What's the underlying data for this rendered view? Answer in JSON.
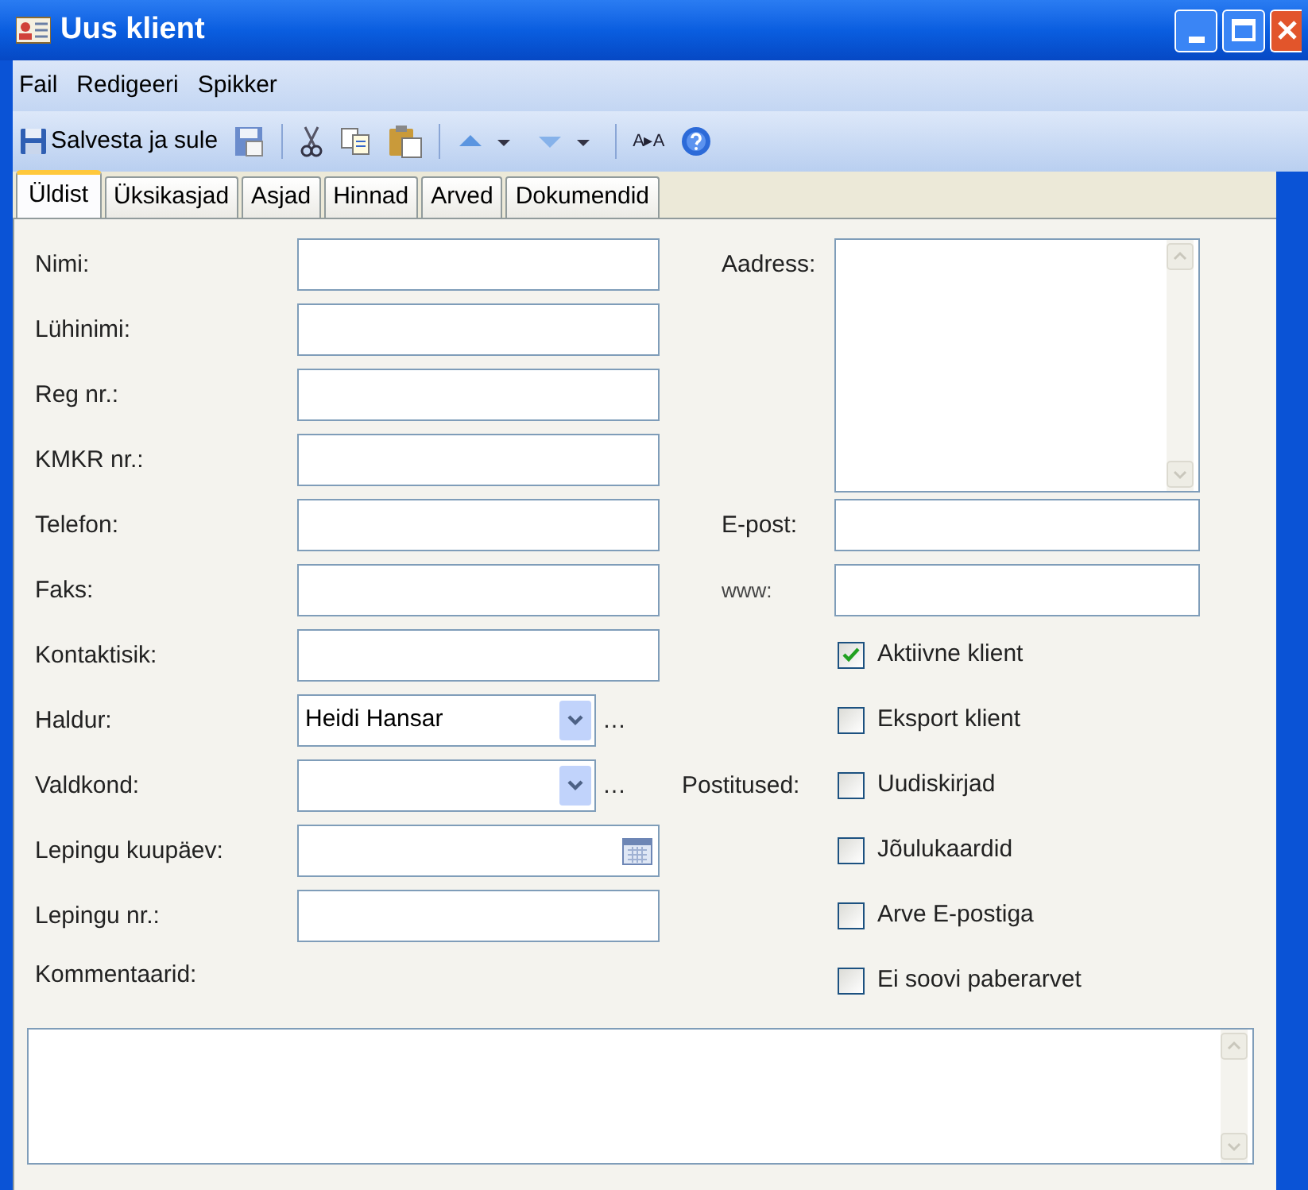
{
  "window": {
    "title": "Uus klient"
  },
  "menu": [
    "Fail",
    "Redigeeri",
    "Spikker"
  ],
  "toolbar": {
    "save_close": "Salvesta ja sule",
    "font_size": "A▸A"
  },
  "tabs": [
    {
      "label": "Üldist",
      "selected": true
    },
    {
      "label": "Üksikasjad",
      "selected": false
    },
    {
      "label": "Asjad",
      "selected": false
    },
    {
      "label": "Hinnad",
      "selected": false
    },
    {
      "label": "Arved",
      "selected": false
    },
    {
      "label": "Dokumendid",
      "selected": false
    }
  ],
  "left_fields": [
    {
      "label": "Nimi:",
      "kind": "text"
    },
    {
      "label": "Lühinimi:",
      "kind": "text"
    },
    {
      "label": "Reg nr.:",
      "kind": "text"
    },
    {
      "label": "KMKR nr.:",
      "kind": "text"
    },
    {
      "label": "Telefon:",
      "kind": "text"
    },
    {
      "label": "Faks:",
      "kind": "text"
    },
    {
      "label": "Kontaktisik:",
      "kind": "text"
    },
    {
      "label": "Haldur:",
      "kind": "combo",
      "value": "Heidi Hansar",
      "more": "…"
    },
    {
      "label": "Valdkond:",
      "kind": "combo",
      "more": "…"
    },
    {
      "label": "Lepingu kuupäev:",
      "kind": "date"
    },
    {
      "label": "Lepingu nr.:",
      "kind": "text"
    }
  ],
  "address": {
    "label": "Aadress:"
  },
  "email": {
    "label": "E-post:"
  },
  "www": {
    "label": "www:"
  },
  "checkboxes": [
    {
      "label": "Aktiivne klient",
      "checked": true
    },
    {
      "label": "Eksport klient",
      "checked": false
    },
    {
      "label": "Uudiskirjad",
      "checked": false,
      "group_label": "Postitused:"
    },
    {
      "label": "Jõulukaardid",
      "checked": false
    },
    {
      "label": "Arve E-postiga",
      "checked": false
    },
    {
      "label": "Ei soovi paberarvet",
      "checked": false
    }
  ],
  "comments": {
    "label": "Kommentaarid:"
  }
}
